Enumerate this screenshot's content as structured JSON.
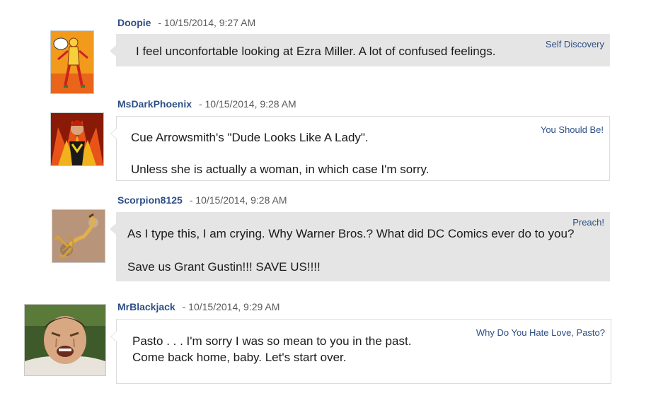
{
  "comments": [
    {
      "username": "Doopie",
      "timestamp": "10/15/2014, 9:27 AM",
      "tag": "Self Discovery",
      "lines": [
        "I feel unconfortable looking at Ezra Miller. A lot of confused feelings."
      ],
      "avatar": "superhero-avatar-icon"
    },
    {
      "username": "MsDarkPhoenix",
      "timestamp": "10/15/2014, 9:28 AM",
      "tag": "You Should Be!",
      "lines": [
        "Cue Arrowsmith's \"Dude Looks Like A Lady\".",
        "Unless she is actually a woman, in which case I'm sorry."
      ],
      "avatar": "phoenix-avatar-icon"
    },
    {
      "username": "Scorpion8125",
      "timestamp": "10/15/2014, 9:28 AM",
      "tag": "Preach!",
      "lines": [
        "As I type this, I am crying. Why Warner Bros.? What did DC Comics ever do to you?",
        "Save us Grant Gustin!!! SAVE US!!!!"
      ],
      "avatar": "scorpion-avatar-icon"
    },
    {
      "username": "MrBlackjack",
      "timestamp": "10/15/2014, 9:29 AM",
      "tag": "Why Do You Hate Love, Pasto?",
      "lines": [
        "Pasto . . . I'm sorry I was so mean to you in the past.",
        "Come back home, baby. Let's start over."
      ],
      "avatar": "crying-man-avatar-icon"
    }
  ],
  "separator": "-",
  "colors": {
    "username": "#2d4f86",
    "tag": "#2d4f86",
    "bubble_grey": "#e5e5e5",
    "bubble_border": "#dcdcdc"
  }
}
